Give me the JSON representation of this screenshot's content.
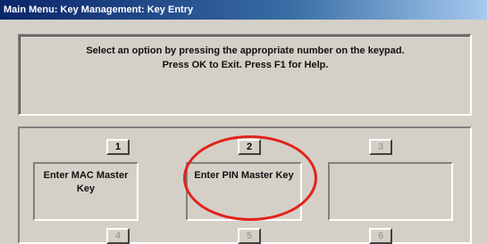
{
  "window": {
    "title": "Main Menu: Key Management: Key Entry"
  },
  "prompt": {
    "line1": "Select an option by pressing the appropriate number on the keypad.",
    "line2": "Press OK to Exit.  Press F1 for Help."
  },
  "options": [
    {
      "number": "1",
      "label": "Enter MAC Master Key",
      "enabled": true
    },
    {
      "number": "2",
      "label": "Enter PIN Master Key",
      "enabled": true
    },
    {
      "number": "3",
      "label": "",
      "enabled": false
    },
    {
      "number": "4",
      "label": "",
      "enabled": false
    },
    {
      "number": "5",
      "label": "",
      "enabled": false
    },
    {
      "number": "6",
      "label": "",
      "enabled": false
    }
  ],
  "colors": {
    "title_bar": "#0a246a",
    "face": "#d4d0c8",
    "highlight_ring": "#e2231a"
  }
}
